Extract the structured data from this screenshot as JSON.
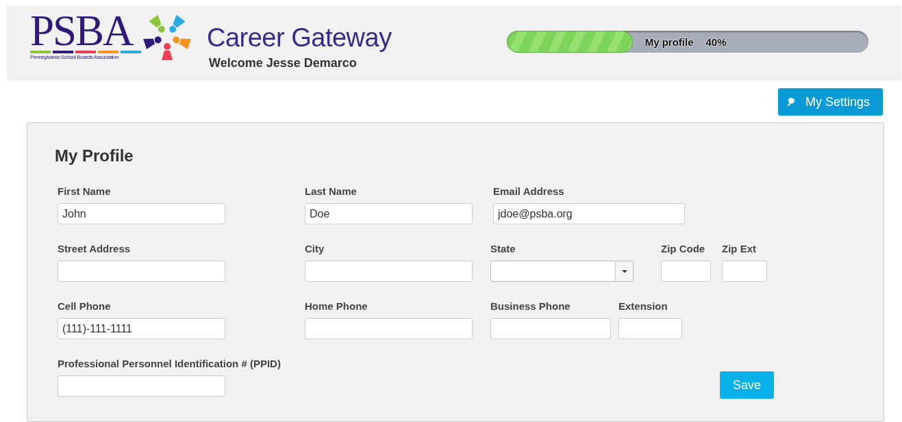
{
  "header": {
    "logo_text": "PSBA",
    "logo_subtitle": "Pennsylvania School Boards Association",
    "app_title": "Career Gateway",
    "welcome": "Welcome Jesse Demarco"
  },
  "progress": {
    "label": "My profile",
    "percent": "40%",
    "level": 0.35
  },
  "settings_button": "My Settings",
  "profile": {
    "title": "My Profile",
    "rows": [
      [
        {
          "label": "First Name",
          "kind": "text",
          "value": "John"
        },
        {
          "label": "Last Name",
          "kind": "text",
          "value": "Doe"
        },
        {
          "label": "Email Address",
          "kind": "text",
          "value": "jdoe@psba.org"
        }
      ],
      [
        {
          "label": "Street Address",
          "kind": "text"
        },
        {
          "label": "City",
          "kind": "text"
        },
        {
          "label": "State",
          "kind": "select"
        },
        {
          "label": "Zip Code",
          "kind": "text"
        },
        {
          "label": "Zip Ext",
          "kind": "text"
        }
      ],
      [
        {
          "label": "Cell Phone",
          "kind": "text",
          "value": "(111)-111-1111"
        },
        {
          "label": "Home Phone",
          "kind": "text"
        },
        {
          "label": "Business Phone",
          "kind": "text"
        },
        {
          "label": "Extension",
          "kind": "text"
        }
      ],
      [
        {
          "label": "Professional Personnel Identification # (PPID)",
          "kind": "text"
        }
      ]
    ],
    "save_button": "Save"
  }
}
